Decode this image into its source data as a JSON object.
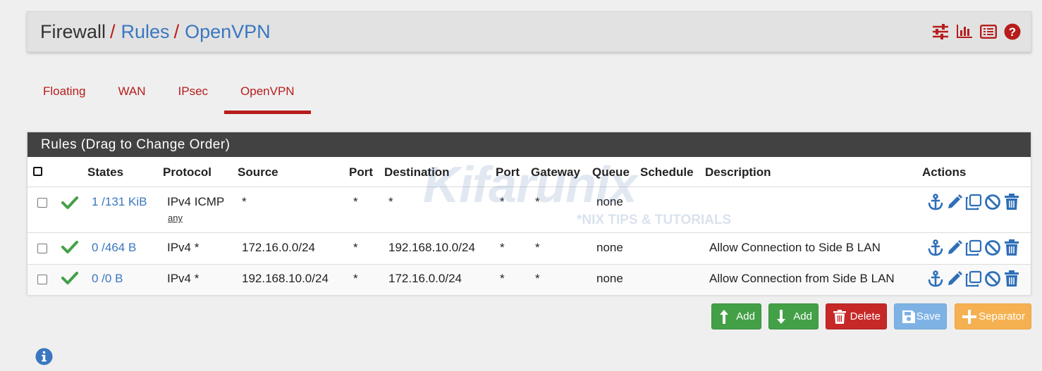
{
  "breadcrumb": {
    "root": "Firewall",
    "sep": "/",
    "rules": "Rules",
    "current": "OpenVPN",
    "icons": [
      "sliders-icon",
      "bar-chart-icon",
      "list-icon",
      "help-icon"
    ]
  },
  "tabs": [
    {
      "label": "Floating",
      "active": false
    },
    {
      "label": "WAN",
      "active": false
    },
    {
      "label": "IPsec",
      "active": false
    },
    {
      "label": "OpenVPN",
      "active": true
    }
  ],
  "panel": {
    "title": "Rules (Drag to Change Order)"
  },
  "columns": {
    "states": "States",
    "protocol": "Protocol",
    "source": "Source",
    "src_port": "Port",
    "destination": "Destination",
    "dst_port": "Port",
    "gateway": "Gateway",
    "queue": "Queue",
    "schedule": "Schedule",
    "description": "Description",
    "actions": "Actions"
  },
  "rows": [
    {
      "states": "1 /131 KiB",
      "protocol": "IPv4 ICMP",
      "protocol_sub": "any",
      "source": "*",
      "src_port": "*",
      "destination": "*",
      "dst_port": "*",
      "gateway": "*",
      "queue": "none",
      "schedule": "",
      "description": ""
    },
    {
      "states": "0 /464 B",
      "protocol": "IPv4 *",
      "protocol_sub": "",
      "source": "172.16.0.0/24",
      "src_port": "*",
      "destination": "192.168.10.0/24",
      "dst_port": "*",
      "gateway": "*",
      "queue": "none",
      "schedule": "",
      "description": "Allow Connection to Side B LAN"
    },
    {
      "states": "0 /0 B",
      "protocol": "IPv4 *",
      "protocol_sub": "",
      "source": "192.168.10.0/24",
      "src_port": "*",
      "destination": "172.16.0.0/24",
      "dst_port": "*",
      "gateway": "*",
      "queue": "none",
      "schedule": "",
      "description": "Allow Connection from Side B LAN"
    }
  ],
  "buttons": {
    "add_top": "Add",
    "add_bottom": "Add",
    "delete": "Delete",
    "save": "Save",
    "separator": "Separator"
  },
  "watermark": {
    "brand": "Kifarunix",
    "tagline": "*NIX TIPS & TUTORIALS"
  },
  "colors": {
    "accent_red": "#b71c1c",
    "link_blue": "#3a77c0",
    "check_green": "#43a047",
    "action_blue": "#2e6fb8"
  }
}
